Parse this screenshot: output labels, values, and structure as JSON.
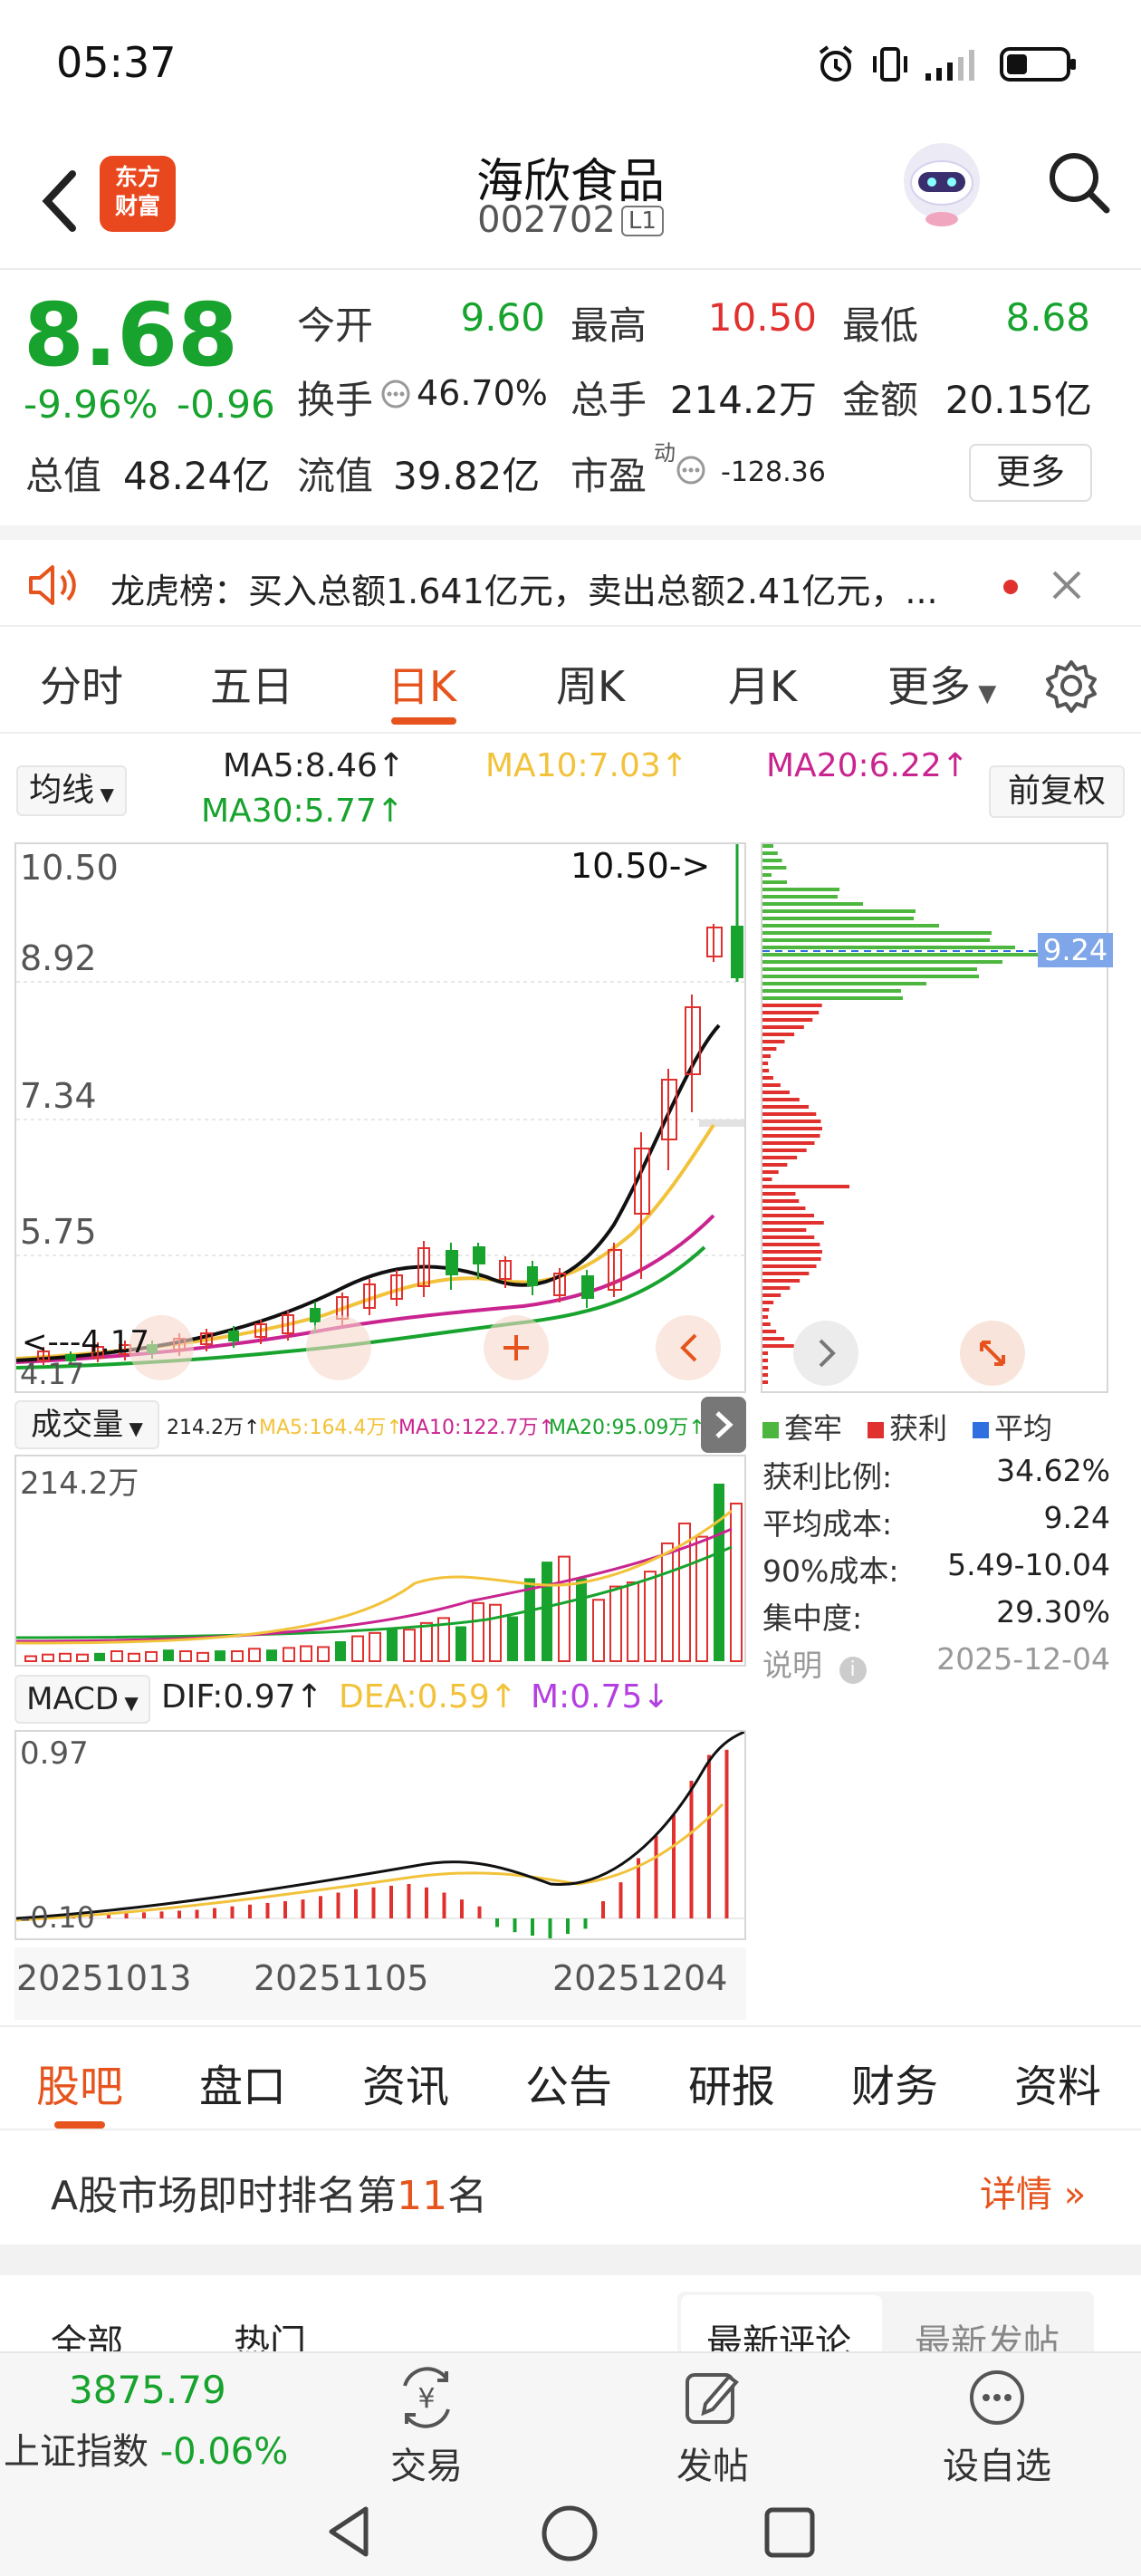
{
  "status_bar": {
    "time": "05:37"
  },
  "header": {
    "app_logo_line1": "东方",
    "app_logo_line2": "财富",
    "stock_name": "海欣食品",
    "stock_code": "002702",
    "level": "L1"
  },
  "quote": {
    "price": "8.68",
    "change_pct": "-9.96%",
    "change": "-0.96",
    "rows": [
      [
        {
          "label": "今开",
          "value": "9.60",
          "color": "#17a32d"
        },
        {
          "label": "最高",
          "value": "10.50",
          "color": "#e0312f"
        },
        {
          "label": "最低",
          "value": "8.68",
          "color": "#17a32d"
        }
      ],
      [
        {
          "label": "换手",
          "value": "46.70%"
        },
        {
          "label": "总手",
          "value": "214.2万"
        },
        {
          "label": "金额",
          "value": "20.15亿"
        }
      ]
    ],
    "total_value_label": "总值",
    "total_value": "48.24亿",
    "float_value_label": "流值",
    "float_value": "39.82亿",
    "pe_label": "市盈",
    "pe_superscript": "动",
    "pe_value": "-128.36",
    "more_label": "更多"
  },
  "notice": {
    "text": "龙虎榜：买入总额1.641亿元，卖出总额2.41亿元，..."
  },
  "period_tabs": [
    "分时",
    "五日",
    "日K",
    "周K",
    "月K",
    "更多"
  ],
  "period_active": "日K",
  "ma": {
    "selector": "均线",
    "ma5": "MA5:8.46↑",
    "ma10": "MA10:7.03↑",
    "ma20": "MA20:6.22↑",
    "ma30": "MA30:5.77↑",
    "adjust": "前复权"
  },
  "kline": {
    "y_labels": [
      "10.50",
      "8.92",
      "7.34",
      "5.75"
    ],
    "high_marker": "10.50->",
    "low_marker": "<---4.17",
    "bottom_label": "4.17"
  },
  "chips": {
    "avg_marker": "9.24"
  },
  "volume": {
    "selector": "成交量",
    "total": "214.2万↑",
    "ma5": "MA5:164.4万↑",
    "ma10": "MA10:122.7万↑",
    "ma20": "MA20:95.09万↑",
    "y_max": "214.2万"
  },
  "macd": {
    "selector": "MACD",
    "dif": "DIF:0.97↑",
    "dea": "DEA:0.59↑",
    "m": "M:0.75↓",
    "y_max": "0.97",
    "y_low": "-0.10"
  },
  "dates": [
    "20251013",
    "20251105",
    "20251204"
  ],
  "chip_stats": {
    "legend": [
      "套牢",
      "获利",
      "平均"
    ],
    "legend_colors": [
      "#4cb63f",
      "#e0312f",
      "#2f6fe0"
    ],
    "rows": [
      {
        "label": "获利比例:",
        "value": "34.62%"
      },
      {
        "label": "平均成本:",
        "value": "9.24"
      },
      {
        "label": "90%成本:",
        "value": "5.49-10.04"
      },
      {
        "label": "集中度:",
        "value": "29.30%"
      }
    ],
    "note_label": "说明",
    "note_date": "2025-12-04"
  },
  "bottom_tabs": [
    "股吧",
    "盘口",
    "资讯",
    "公告",
    "研报",
    "财务",
    "资料"
  ],
  "rank": {
    "prefix": "A股市场即时排名第",
    "number": "11",
    "suffix": "名",
    "detail": "详情"
  },
  "comment_tabs": [
    "全部",
    "热门",
    "最新评论",
    "最新发帖"
  ],
  "bottom_bar": {
    "index_value": "3875.79",
    "index_name": "上证指数",
    "index_change": "-0.06%",
    "trade": "交易",
    "post": "发帖",
    "watchlist": "设自选"
  }
}
